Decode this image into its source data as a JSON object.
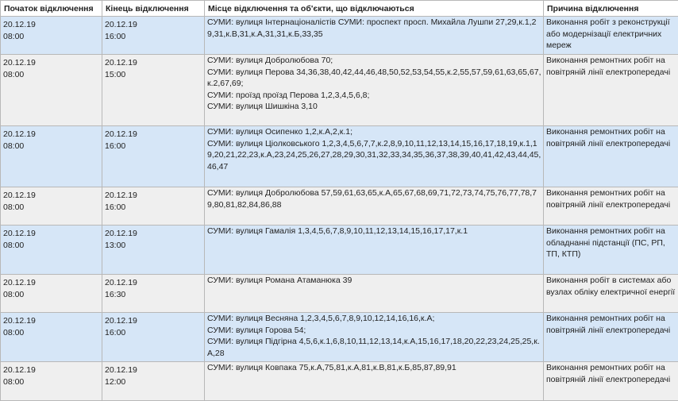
{
  "headers": {
    "start": "Початок відключення",
    "end": "Кінець відключення",
    "place": "Місце відключення та об'єкти, що відключаються",
    "reason": "Причина відключення"
  },
  "rows": [
    {
      "start_date": "20.12.19",
      "start_time": "08:00",
      "end_date": "20.12.19",
      "end_time": "16:00",
      "place": [
        "СУМИ: вулиця Інтернаціоналістів СУМИ: проспект просп. Михайла Лушпи 27,29,к.1,29,31,к.В,31,к.А,31,31,к.Б,33,35"
      ],
      "reason": "Виконання робіт з реконструкції або модернізації електричних мереж"
    },
    {
      "start_date": "20.12.19",
      "start_time": "08:00",
      "end_date": "20.12.19",
      "end_time": "15:00",
      "place": [
        "СУМИ: вулиця Добролюбова 70;",
        "СУМИ: вулиця Перова 34,36,38,40,42,44,46,48,50,52,53,54,55,к.2,55,57,59,61,63,65,67,к.2,67,69;",
        "СУМИ: проїзд проїзд Перова 1,2,3,4,5,6,8;",
        "СУМИ: вулиця Шишкіна 3,10"
      ],
      "reason": "Виконання ремонтних робіт на повітряній лінії електропередачі"
    },
    {
      "start_date": "20.12.19",
      "start_time": "08:00",
      "end_date": "20.12.19",
      "end_time": "16:00",
      "place": [
        "СУМИ: вулиця Осипенко 1,2,к.А,2,к.1;",
        "СУМИ: вулиця Ціолковського 1,2,3,4,5,6,7,7,к.2,8,9,10,11,12,13,14,15,16,17,18,19,к.1,19,20,21,22,23,к.А,23,24,25,26,27,28,29,30,31,32,33,34,35,36,37,38,39,40,41,42,43,44,45,46,47"
      ],
      "reason": "Виконання ремонтних робіт на повітряній лінії електропередачі"
    },
    {
      "start_date": "20.12.19",
      "start_time": "08:00",
      "end_date": "20.12.19",
      "end_time": "16:00",
      "place": [
        "СУМИ: вулиця Добролюбова 57,59,61,63,65,к.А,65,67,68,69,71,72,73,74,75,76,77,78,79,80,81,82,84,86,88"
      ],
      "reason": "Виконання ремонтних робіт на повітряній лінії електропередачі"
    },
    {
      "start_date": "20.12.19",
      "start_time": "08:00",
      "end_date": "20.12.19",
      "end_time": "13:00",
      "place": [
        "СУМИ: вулиця Гамалія 1,3,4,5,6,7,8,9,10,11,12,13,14,15,16,17,17,к.1"
      ],
      "reason": "Виконання ремонтних робіт на обладнанні підстанції (ПС, РП, ТП, КТП)"
    },
    {
      "start_date": "20.12.19",
      "start_time": "08:00",
      "end_date": "20.12.19",
      "end_time": "16:30",
      "place": [
        "СУМИ: вулиця Романа Атаманюка 39"
      ],
      "reason": "Виконання робіт в системах або вузлах обліку електричної енергії"
    },
    {
      "start_date": "20.12.19",
      "start_time": "08:00",
      "end_date": "20.12.19",
      "end_time": "16:00",
      "place": [
        "СУМИ: вулиця Весняна 1,2,3,4,5,6,7,8,9,10,12,14,16,16,к.А;",
        "СУМИ: вулиця Горова 54;",
        "СУМИ: вулиця Підгірна 4,5,6,к.1,6,8,10,11,12,13,14,к.А,15,16,17,18,20,22,23,24,25,25,к.А,28"
      ],
      "reason": "Виконання ремонтних робіт на повітряній лінії електропередачі"
    },
    {
      "start_date": "20.12.19",
      "start_time": "08:00",
      "end_date": "20.12.19",
      "end_time": "12:00",
      "place": [
        "СУМИ: вулиця Ковпака 75,к.А,75,81,к.А,81,к.В,81,к.Б,85,87,89,91"
      ],
      "reason": "Виконання ремонтних робіт на повітряній лінії електропередачі"
    }
  ]
}
